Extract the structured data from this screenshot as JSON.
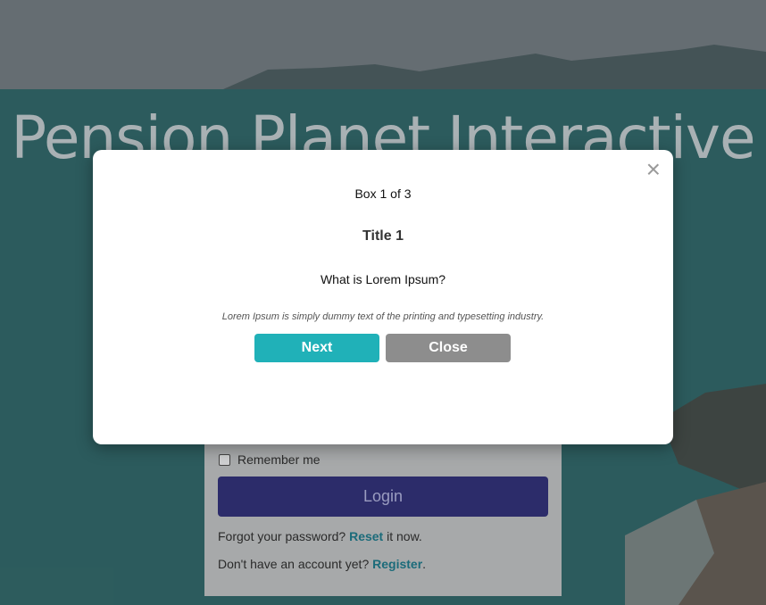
{
  "background": {
    "hero_title": "Pension Planet Interactive"
  },
  "login": {
    "remember_label": "Remember me",
    "login_button": "Login",
    "forgot_prefix": "Forgot your password?",
    "forgot_link": "Reset",
    "forgot_suffix": " it now.",
    "register_prefix": "Don't have an account yet?",
    "register_link": "Register",
    "register_suffix": "."
  },
  "modal": {
    "close_icon": "×",
    "counter": "Box 1 of 3",
    "title": "Title 1",
    "question": "What is Lorem Ipsum?",
    "body": "Lorem Ipsum is simply dummy text of the printing and typesetting industry.",
    "next_button": "Next",
    "close_button": "Close"
  },
  "colors": {
    "next_button": "#20b1b8",
    "close_button": "#8d8d8d",
    "login_button": "#2c2c6a",
    "link": "#1b6b7a"
  }
}
